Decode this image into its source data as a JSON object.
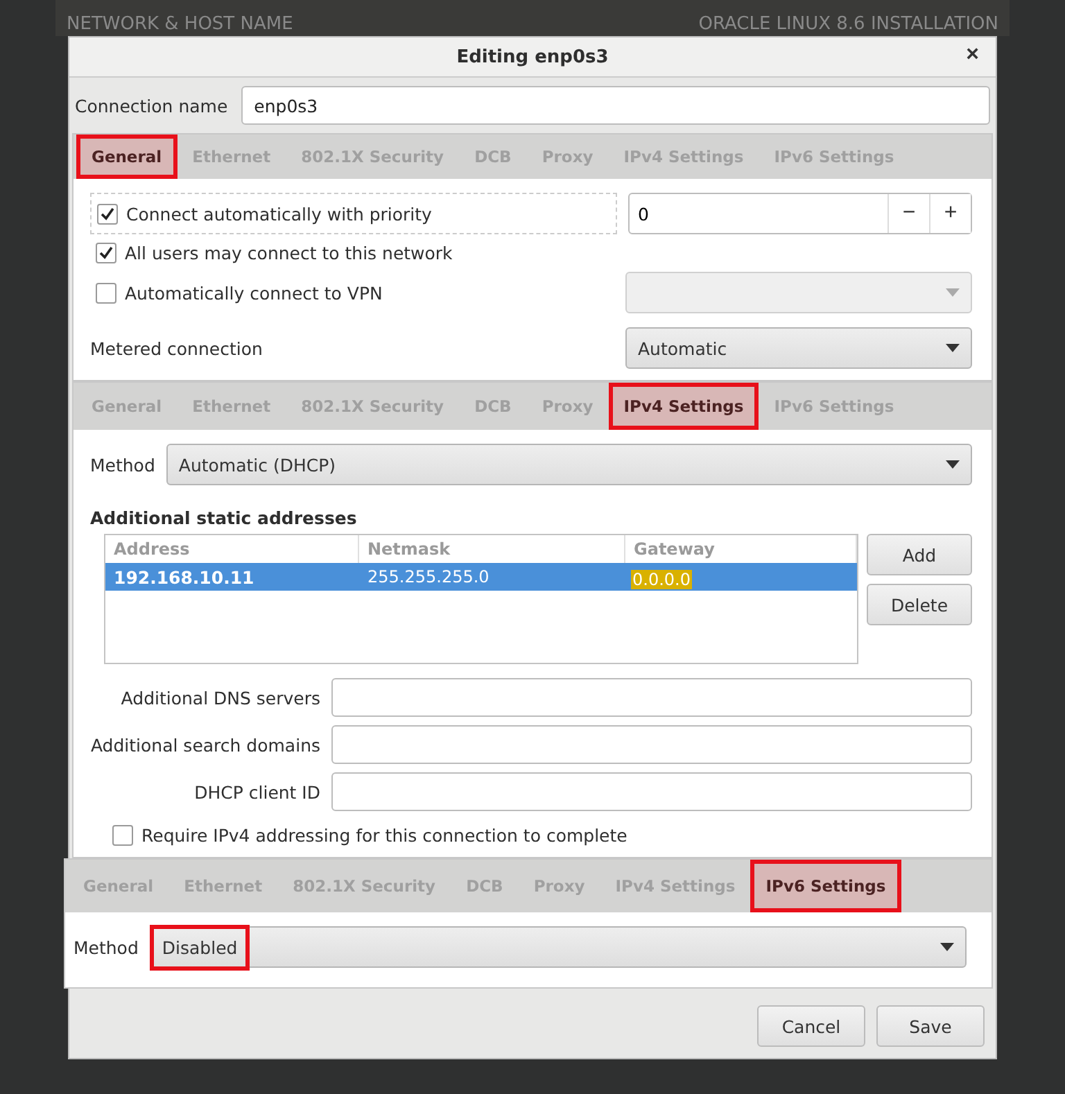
{
  "background": {
    "section_title": "NETWORK & HOST NAME",
    "installer_title": "ORACLE LINUX 8.6 INSTALLATION"
  },
  "dialog": {
    "title": "Editing enp0s3",
    "close": "×"
  },
  "connection_name": {
    "label": "Connection name",
    "value": "enp0s3"
  },
  "general_panel": {
    "highlighted": true,
    "tabs": [
      {
        "label": "General",
        "selected": true
      },
      {
        "label": "Ethernet",
        "selected": false
      },
      {
        "label": "802.1X Security",
        "selected": false
      },
      {
        "label": "DCB",
        "selected": false
      },
      {
        "label": "Proxy",
        "selected": false
      },
      {
        "label": "IPv4 Settings",
        "selected": false
      },
      {
        "label": "IPv6 Settings",
        "selected": false
      }
    ],
    "auto_connect": {
      "label": "Connect automatically with priority",
      "checked": true
    },
    "priority": {
      "value": "0",
      "decrement": "−",
      "increment": "+"
    },
    "all_users": {
      "label": "All users may connect to this network",
      "checked": true
    },
    "vpn": {
      "label": "Automatically connect to VPN",
      "checked": false,
      "disabled": true
    },
    "metered": {
      "label": "Metered connection",
      "value": "Automatic"
    }
  },
  "ipv4_panel": {
    "highlighted": true,
    "tabs": [
      {
        "label": "General",
        "selected": false
      },
      {
        "label": "Ethernet",
        "selected": false
      },
      {
        "label": "802.1X Security",
        "selected": false
      },
      {
        "label": "DCB",
        "selected": false
      },
      {
        "label": "Proxy",
        "selected": false
      },
      {
        "label": "IPv4 Settings",
        "selected": true
      },
      {
        "label": "IPv6 Settings",
        "selected": false
      }
    ],
    "method": {
      "label": "Method",
      "value": "Automatic (DHCP)"
    },
    "addresses_title": "Additional static addresses",
    "columns": [
      "Address",
      "Netmask",
      "Gateway"
    ],
    "rows": [
      {
        "address": "192.168.10.11",
        "netmask": "255.255.255.0",
        "gateway": "0.0.0.0",
        "selected": true,
        "gateway_highlighted": true
      }
    ],
    "buttons": [
      "Add",
      "Delete"
    ],
    "fields": [
      {
        "label": "Additional DNS servers"
      },
      {
        "label": "Additional search domains"
      },
      {
        "label": "DHCP client ID"
      }
    ],
    "require": {
      "label": "Require IPv4 addressing for this connection to complete",
      "checked": false
    }
  },
  "ipv6_panel": {
    "highlighted": true,
    "tabs": [
      {
        "label": "General",
        "selected": false
      },
      {
        "label": "Ethernet",
        "selected": false
      },
      {
        "label": "802.1X Security",
        "selected": false
      },
      {
        "label": "DCB",
        "selected": false
      },
      {
        "label": "Proxy",
        "selected": false
      },
      {
        "label": "IPv4 Settings",
        "selected": false
      },
      {
        "label": "IPv6 Settings",
        "selected": true
      }
    ],
    "method": {
      "label": "Method",
      "value": "Disabled",
      "highlighted": true
    }
  },
  "footer_buttons": [
    "Cancel",
    "Save"
  ]
}
